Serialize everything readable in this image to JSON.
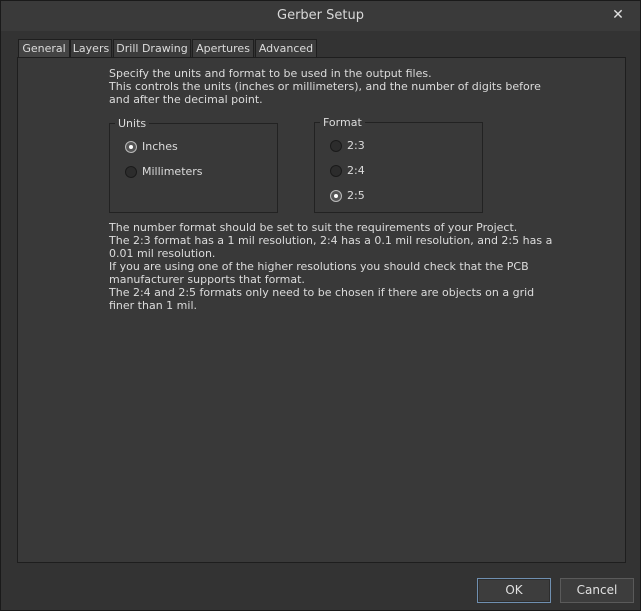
{
  "window": {
    "title": "Gerber Setup",
    "close_glyph": "✕"
  },
  "tabs": [
    {
      "label": "General"
    },
    {
      "label": "Layers"
    },
    {
      "label": "Drill Drawing"
    },
    {
      "label": "Apertures"
    },
    {
      "label": "Advanced"
    }
  ],
  "active_tab": "General",
  "general": {
    "intro": "Specify the units and format to be used in the output files.\nThis controls the units (inches or millimeters), and the number of digits before\nand after the decimal point.",
    "units": {
      "legend": "Units",
      "options": [
        "Inches",
        "Millimeters"
      ],
      "selected": "Inches"
    },
    "format": {
      "legend": "Format",
      "options": [
        "2:3",
        "2:4",
        "2:5"
      ],
      "selected": "2:5"
    },
    "explanation": "The number format should be set to suit the requirements of your Project.\nThe 2:3 format has a 1 mil resolution, 2:4 has a 0.1 mil resolution, and 2:5 has a\n0.01 mil resolution.\nIf you are using one of the higher resolutions you should check that the PCB\nmanufacturer supports that format.\nThe 2:4 and 2:5 formats only need to be chosen if there are objects on a grid\nfiner than 1 mil."
  },
  "buttons": {
    "ok": "OK",
    "cancel": "Cancel"
  }
}
